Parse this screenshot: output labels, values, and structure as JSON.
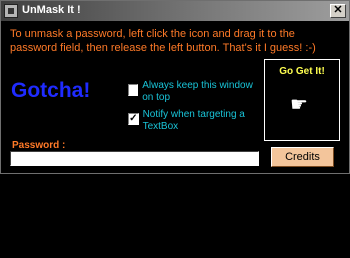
{
  "window": {
    "title": "UnMask It !",
    "close_label": "✕"
  },
  "instructions": "To unmask a password, left click the icon and drag it to the password field, then release the left button. That's it I guess! :-)",
  "gotcha": "Gotcha!",
  "options": [
    {
      "label": "Always keep this window on top",
      "checked": false
    },
    {
      "label": "Notify when targeting a TextBox",
      "checked": true
    }
  ],
  "target_box": {
    "label": "Go Get It!",
    "icon": "pointing-hand-icon"
  },
  "password": {
    "label": "Password :",
    "value": ""
  },
  "credits_button": {
    "label": "Credits"
  },
  "colors": {
    "instructions": "#ff7a28",
    "gotcha": "#1f2bff",
    "option_text": "#19c4d8",
    "go_get_it": "#ffff50",
    "credits_bg": "#f3c59b"
  }
}
